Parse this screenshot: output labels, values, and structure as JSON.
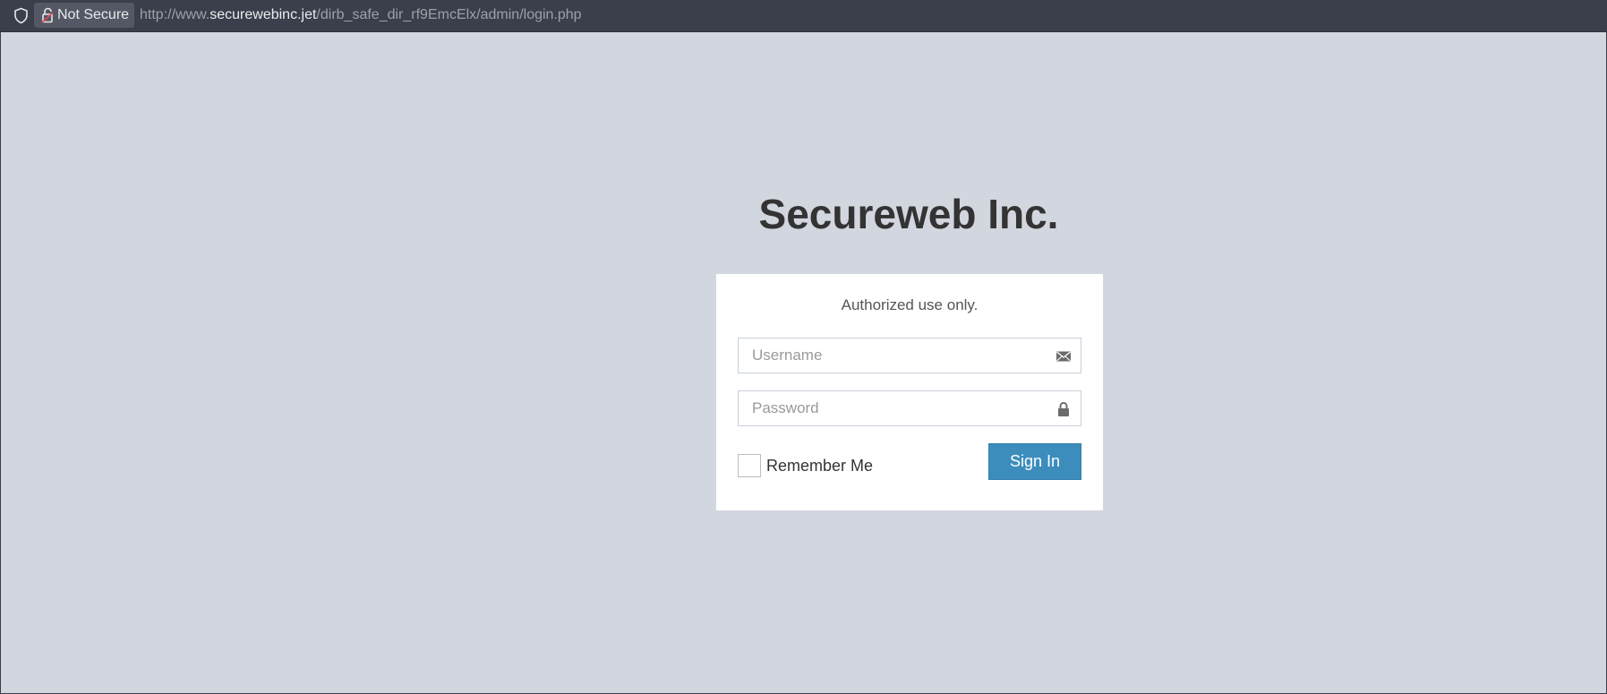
{
  "browser": {
    "security_label": "Not Secure",
    "url_prefix": "http://www.",
    "url_host": "securewebinc.jet",
    "url_path": "/dirb_safe_dir_rf9EmcElx/admin/login.php",
    "icons": {
      "shield": "shield-icon",
      "security": "broken-lock-icon"
    }
  },
  "page": {
    "logo": "Secureweb Inc.",
    "message": "Authorized use only.",
    "username": {
      "value": "",
      "placeholder": "Username",
      "icon": "envelope-icon"
    },
    "password": {
      "value": "",
      "placeholder": "Password",
      "icon": "lock-icon"
    },
    "remember_label": "Remember Me",
    "remember_checked": false,
    "signin_label": "Sign In",
    "colors": {
      "background": "#d2d6de",
      "button": "#3c8dbc",
      "box": "#ffffff"
    }
  }
}
